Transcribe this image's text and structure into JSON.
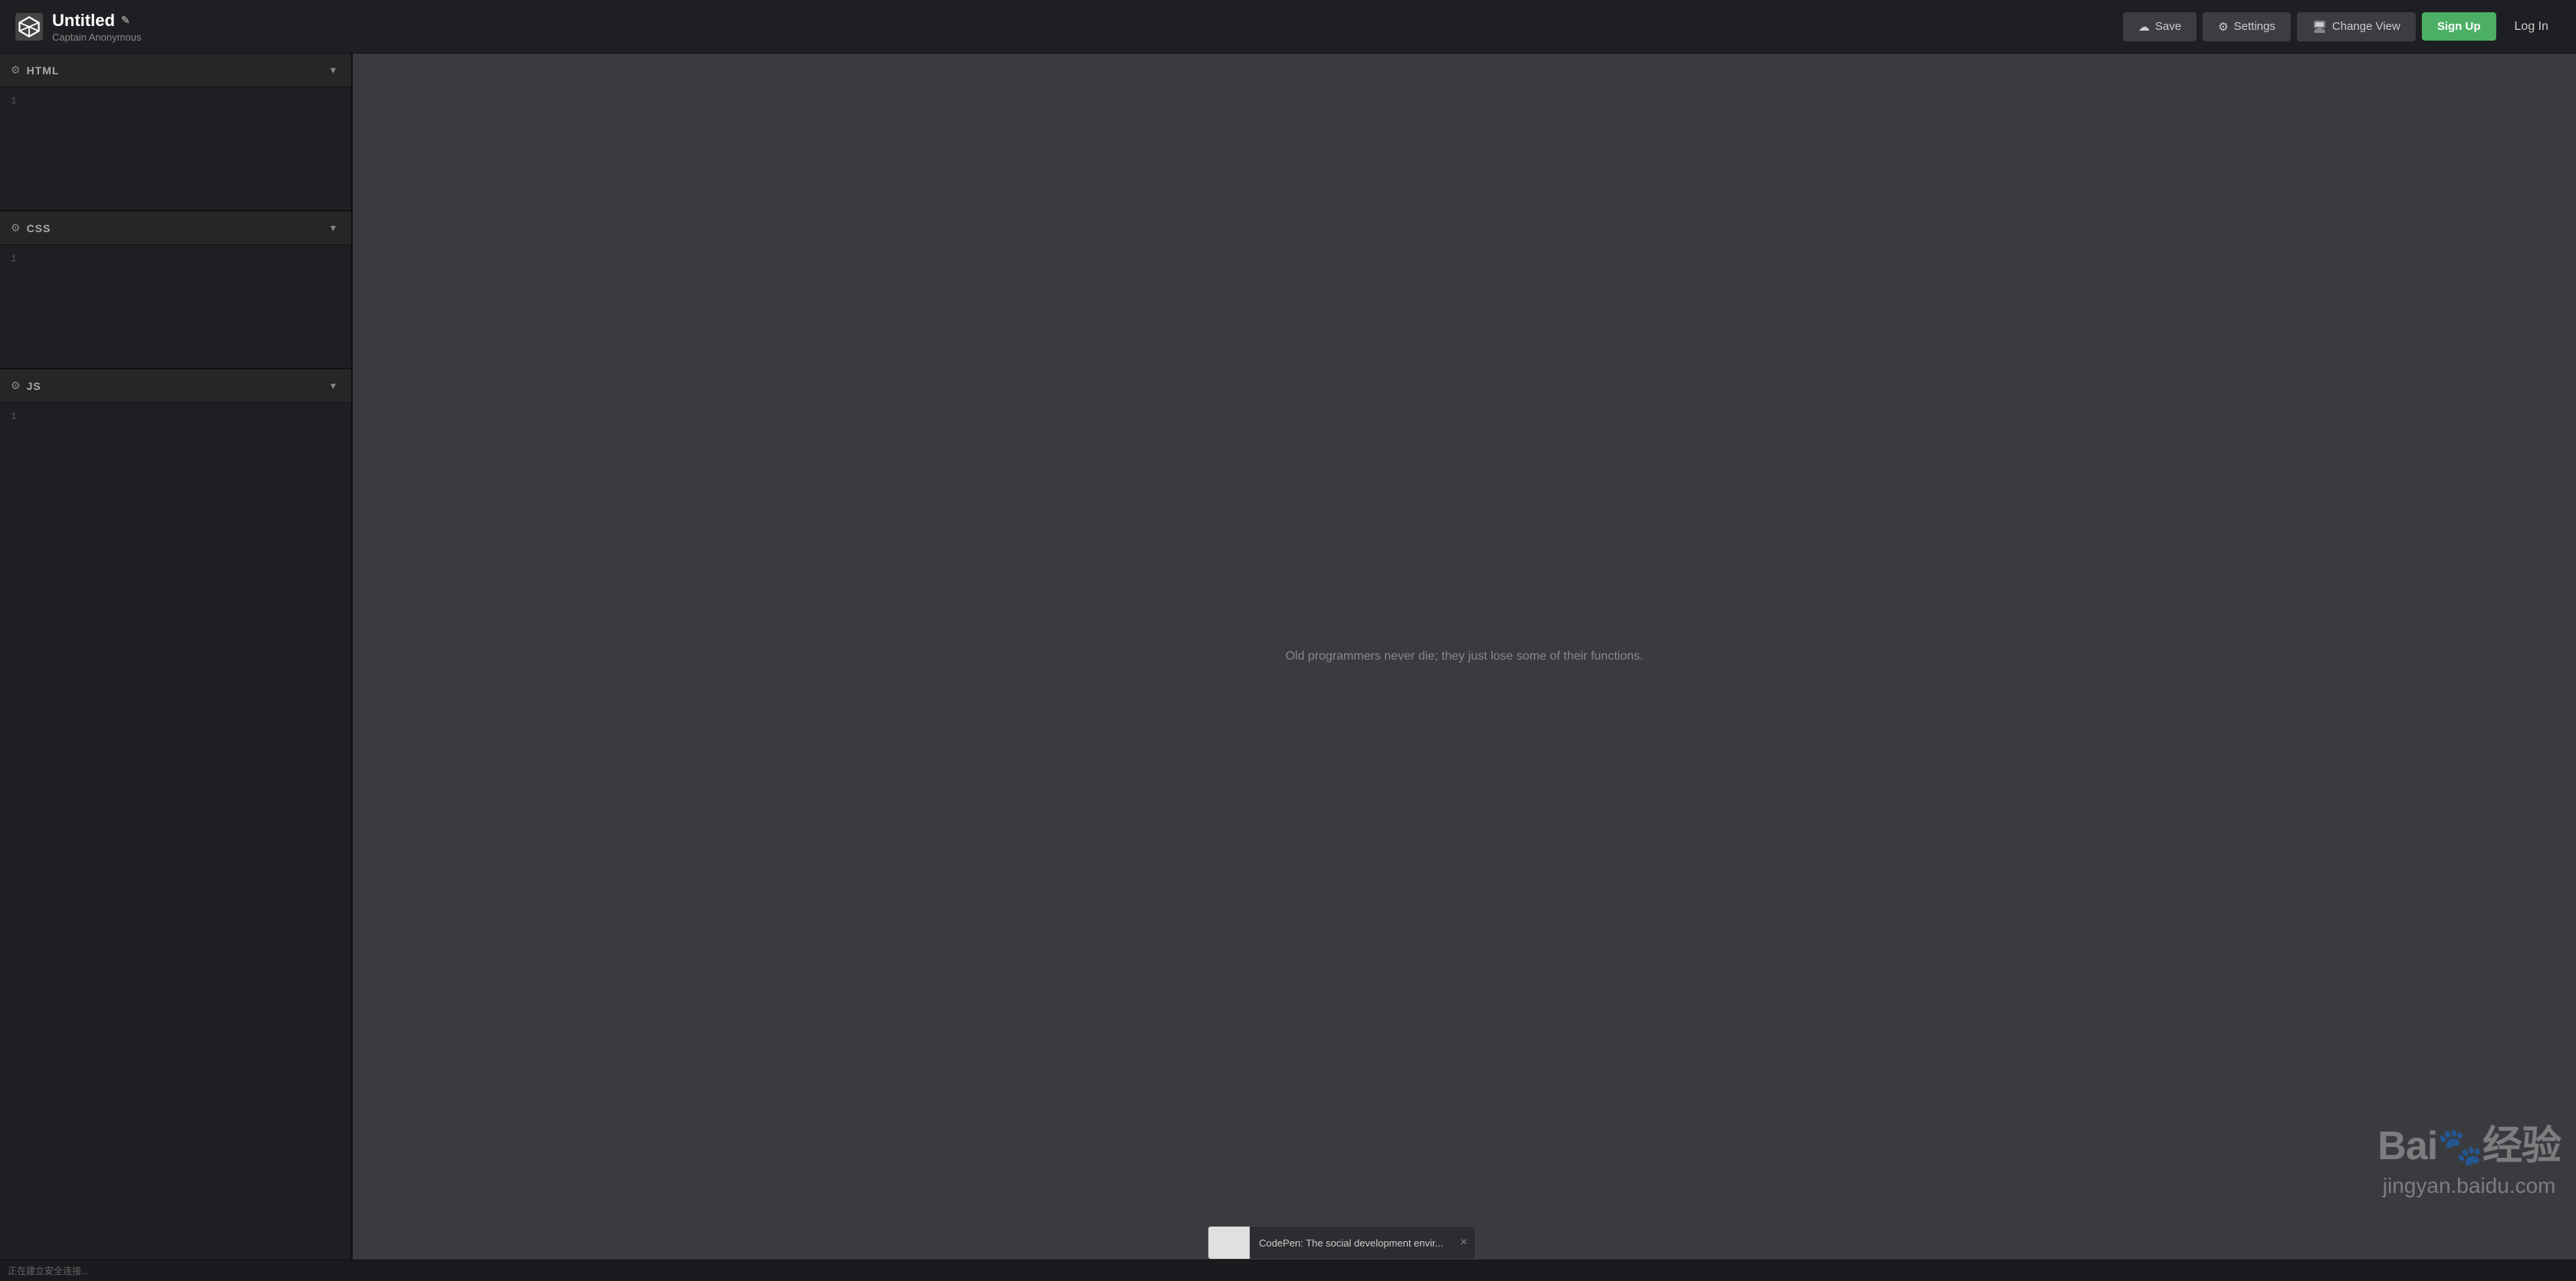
{
  "header": {
    "logo_label": "CP",
    "title": "Untitled",
    "edit_icon": "✎",
    "subtitle": "Captain Anonymous",
    "buttons": {
      "save_label": "Save",
      "settings_label": "Settings",
      "change_view_label": "Change View",
      "signup_label": "Sign Up",
      "login_label": "Log In"
    }
  },
  "panels": [
    {
      "id": "html",
      "title": "HTML",
      "line_number": "1"
    },
    {
      "id": "css",
      "title": "CSS",
      "line_number": "1"
    },
    {
      "id": "js",
      "title": "JS",
      "line_number": "1"
    }
  ],
  "preview": {
    "quote": "Old programmers never die; they just lose some of their functions."
  },
  "watermark": {
    "text": "Bai",
    "paw": "🐾",
    "suffix": "经验",
    "subtitle": "jingyan.baidu.com"
  },
  "statusbar": {
    "text": "正在建立安全连接..."
  },
  "toast": {
    "text": "CodePen: The social development envir...",
    "close_label": "×"
  },
  "colors": {
    "accent_green": "#4caf65",
    "header_bg": "#1e1f22",
    "editor_bg": "#1e1f22",
    "preview_bg": "#3a3b3f"
  }
}
